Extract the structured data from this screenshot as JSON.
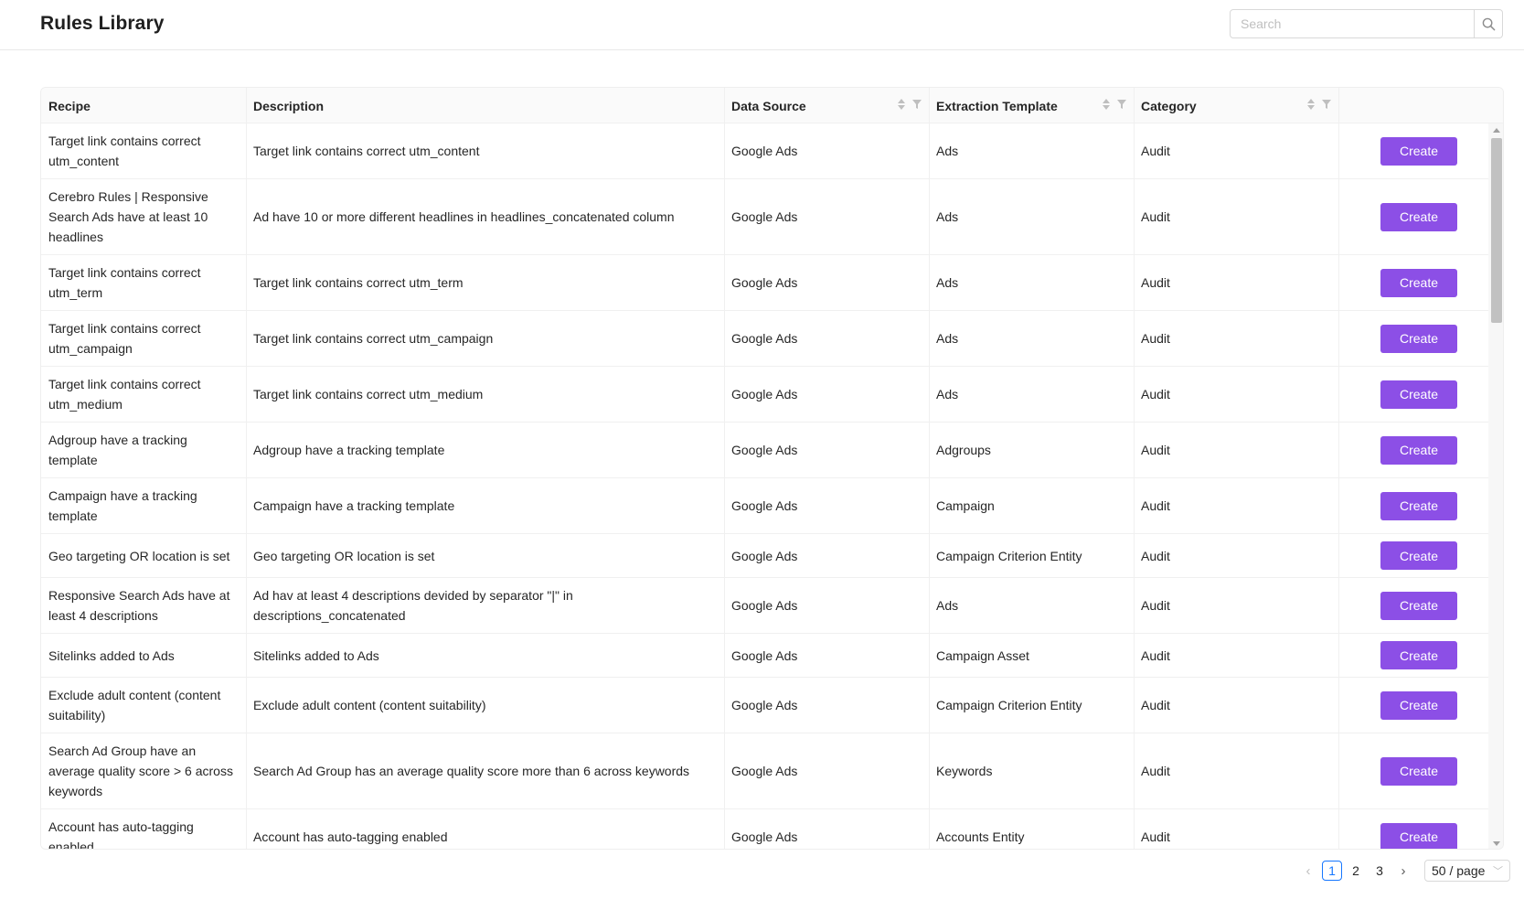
{
  "header": {
    "title": "Rules Library"
  },
  "search": {
    "placeholder": "Search",
    "value": ""
  },
  "table": {
    "columns": [
      "Recipe",
      "Description",
      "Data Source",
      "Extraction Template",
      "Category",
      ""
    ],
    "action_label": "Create",
    "rows": [
      {
        "recipe": "Target link contains correct utm_content",
        "description": "Target link contains correct utm_content",
        "data_source": "Google Ads",
        "template": "Ads",
        "category": "Audit"
      },
      {
        "recipe": "Cerebro Rules | Responsive Search Ads have at least 10 headlines",
        "description": "Ad have 10 or more different headlines in headlines_concatenated column",
        "data_source": "Google Ads",
        "template": "Ads",
        "category": "Audit"
      },
      {
        "recipe": "Target link contains correct utm_term",
        "description": "Target link contains correct utm_term",
        "data_source": "Google Ads",
        "template": "Ads",
        "category": "Audit"
      },
      {
        "recipe": "Target link contains correct utm_campaign",
        "description": "Target link contains correct utm_campaign",
        "data_source": "Google Ads",
        "template": "Ads",
        "category": "Audit"
      },
      {
        "recipe": "Target link contains correct utm_medium",
        "description": "Target link contains correct utm_medium",
        "data_source": "Google Ads",
        "template": "Ads",
        "category": "Audit"
      },
      {
        "recipe": "Adgroup have a tracking template",
        "description": "Adgroup have a tracking template",
        "data_source": "Google Ads",
        "template": "Adgroups",
        "category": "Audit"
      },
      {
        "recipe": "Campaign have a tracking template",
        "description": "Campaign have a tracking template",
        "data_source": "Google Ads",
        "template": "Campaign",
        "category": "Audit"
      },
      {
        "recipe": "Geo targeting OR location is set",
        "description": "Geo targeting OR location is set",
        "data_source": "Google Ads",
        "template": "Campaign Criterion Entity",
        "category": "Audit"
      },
      {
        "recipe": "Responsive Search Ads have at least 4 descriptions",
        "description": "Ad hav at least 4 descriptions devided by separator \"|\" in descriptions_concatenated",
        "data_source": "Google Ads",
        "template": "Ads",
        "category": "Audit"
      },
      {
        "recipe": "Sitelinks added to Ads",
        "description": "Sitelinks added to Ads",
        "data_source": "Google Ads",
        "template": "Campaign Asset",
        "category": "Audit"
      },
      {
        "recipe": "Exclude adult content (content suitability)",
        "description": "Exclude adult content (content suitability)",
        "data_source": "Google Ads",
        "template": "Campaign Criterion Entity",
        "category": "Audit"
      },
      {
        "recipe": "Search Ad Group have an average quality score > 6 across keywords",
        "description": "Search Ad Group has an average quality score more than 6 across keywords",
        "data_source": "Google Ads",
        "template": "Keywords",
        "category": "Audit"
      },
      {
        "recipe": "Account has auto-tagging enabled",
        "description": "Account has auto-tagging enabled",
        "data_source": "Google Ads",
        "template": "Accounts Entity",
        "category": "Audit"
      }
    ]
  },
  "pagination": {
    "prev_icon": "chevron-left-icon",
    "next_icon": "chevron-right-icon",
    "pages": [
      "1",
      "2",
      "3"
    ],
    "current_page": "1",
    "page_size": "50 / page"
  },
  "colors": {
    "primary_button": "#8c4fe6",
    "active_page": "#1677ff"
  }
}
